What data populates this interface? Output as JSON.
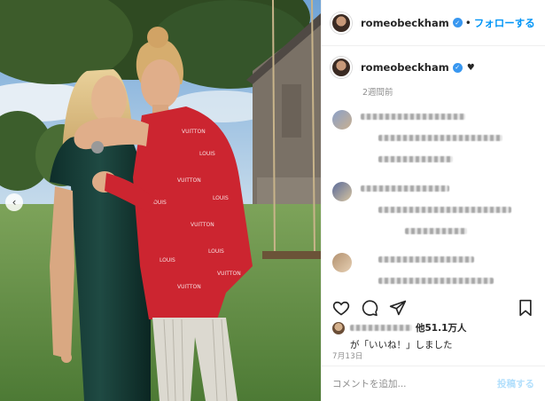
{
  "header": {
    "username": "romeobeckham",
    "separator": "•",
    "follow_label": "フォローする"
  },
  "caption": {
    "username": "romeobeckham",
    "emoji": "♥",
    "time_ago": "2週間前"
  },
  "likes": {
    "count_text": "他51.1万人",
    "suffix_text": "が「いいね！」しました"
  },
  "post_date": "7月13日",
  "comment_box": {
    "placeholder": "コメントを追加...",
    "post_label": "投稿する"
  },
  "icons": {
    "verified": "verified-badge-icon",
    "like": "heart-icon",
    "comment": "comment-bubble-icon",
    "share": "paper-plane-icon",
    "save": "bookmark-icon",
    "prev": "chevron-left-icon"
  },
  "colors": {
    "follow_blue": "#0095f6",
    "verified_blue": "#3897f0",
    "muted_text": "#8e8e8e",
    "post_disabled": "#b2dffc"
  }
}
